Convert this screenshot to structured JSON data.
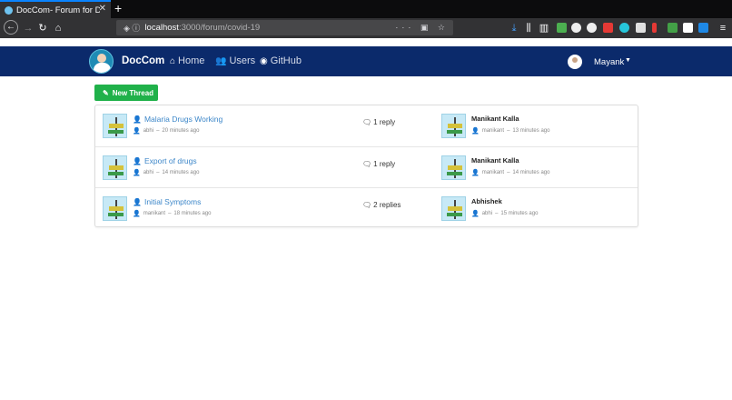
{
  "browser": {
    "tab_title": "DocCom- Forum for Do",
    "url_host": "localhost",
    "url_path": ":3000/forum/covid-19",
    "url_more": "···"
  },
  "nav": {
    "brand": "DocCom",
    "links": [
      {
        "label": "Home",
        "icon": "home-icon"
      },
      {
        "label": "Users",
        "icon": "users-icon"
      },
      {
        "label": "GitHub",
        "icon": "github-icon"
      }
    ],
    "user": "Mayank"
  },
  "new_thread": {
    "label": "New Thread"
  },
  "threads": [
    {
      "title": "Malaria Drugs Working",
      "author": "abhi",
      "time": "20 minutes ago",
      "replies": "1 reply",
      "last_user": "Manikant Kalla",
      "last_handle": "manikant",
      "last_time": "13 minutes ago"
    },
    {
      "title": "Export of drugs",
      "author": "abhi",
      "time": "14 minutes ago",
      "replies": "1 reply",
      "last_user": "Manikant Kalla",
      "last_handle": "manikant",
      "last_time": "14 minutes ago"
    },
    {
      "title": "Initial Symptoms",
      "author": "manikant",
      "time": "18 minutes ago",
      "replies": "2 replies",
      "last_user": "Abhishek",
      "last_handle": "abhi",
      "last_time": "15 minutes ago"
    }
  ]
}
